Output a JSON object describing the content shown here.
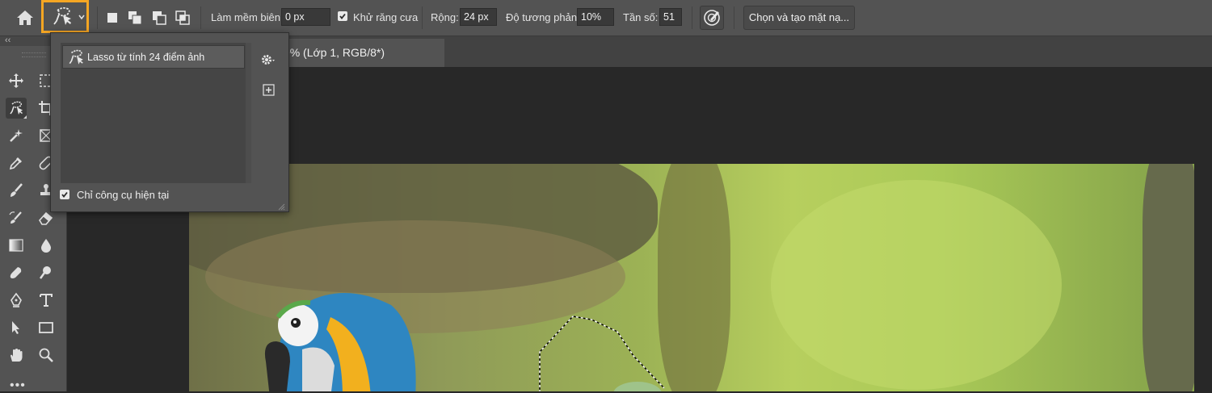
{
  "options_bar": {
    "feather_label": "Làm mềm biên:",
    "feather_value": "0 px",
    "antialias_label": "Khử răng cưa",
    "antialias_checked": true,
    "width_label": "Rộng:",
    "width_value": "24 px",
    "contrast_label": "Độ tương phản:",
    "contrast_value": "10%",
    "frequency_label": "Tần số:",
    "frequency_value": "51",
    "select_mask_label": "Chọn và tạo mặt nạ...",
    "highlight_color": "#f5a623"
  },
  "preset_popup": {
    "items": [
      {
        "label": "Lasso từ tính 24 điểm ảnh",
        "icon": "magnetic-lasso-icon"
      }
    ],
    "current_tool_only_label": "Chỉ công cụ hiện tại",
    "current_tool_only_checked": true
  },
  "document": {
    "tab_title": "png @ 200% (Lớp 1, RGB/8*)"
  },
  "toolbar": {
    "collapse_label": "‹‹",
    "more_label": "•••",
    "tools": [
      "move-tool-icon",
      "marquee-tool-icon",
      "magnetic-lasso-tool-icon",
      "crop-tool-icon",
      "quick-selection-tool-icon",
      "frame-tool-icon",
      "eyedropper-tool-icon",
      "healing-brush-tool-icon",
      "brush-tool-icon",
      "clone-stamp-tool-icon",
      "history-brush-tool-icon",
      "eraser-tool-icon",
      "gradient-tool-icon",
      "blur-tool-icon",
      "smudge-tool-icon",
      "dodge-tool-icon",
      "pen-tool-icon",
      "type-tool-icon",
      "path-selection-tool-icon",
      "rectangle-tool-icon",
      "hand-tool-icon",
      "zoom-tool-icon"
    ]
  }
}
